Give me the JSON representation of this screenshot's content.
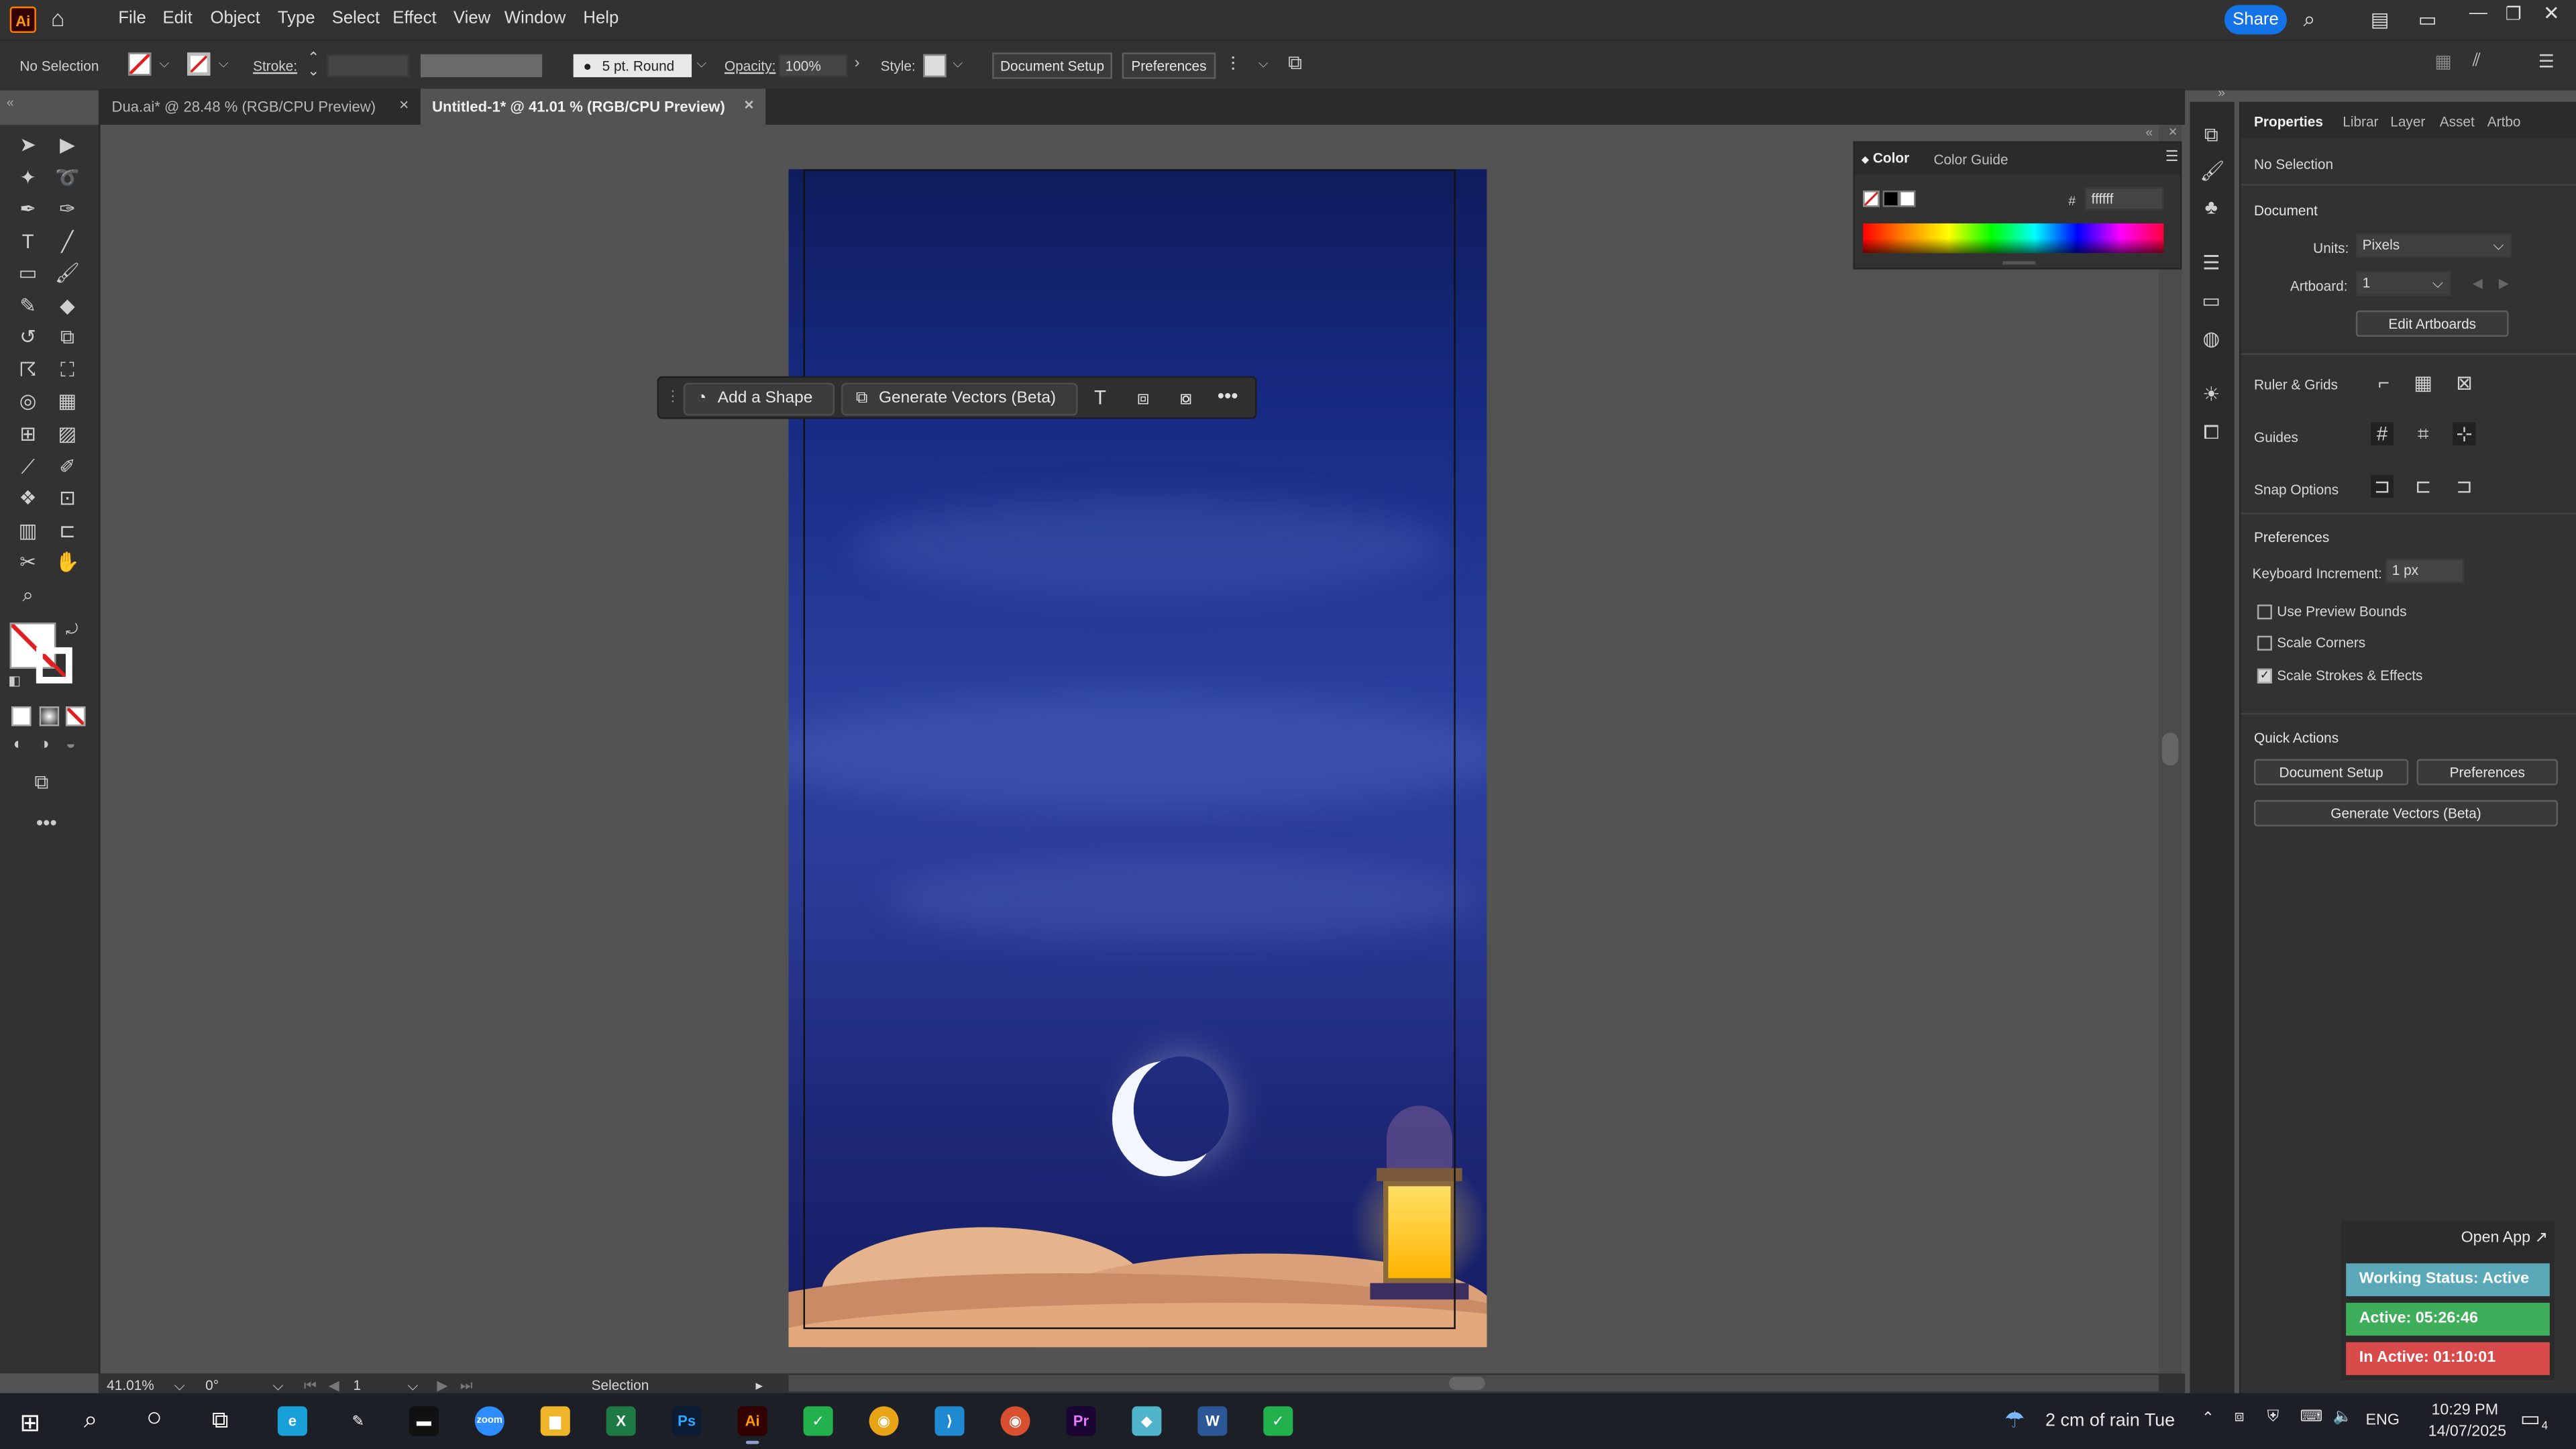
{
  "app": {
    "logo": "Ai"
  },
  "menus": [
    "File",
    "Edit",
    "Object",
    "Type",
    "Select",
    "Effect",
    "View",
    "Window",
    "Help"
  ],
  "header": {
    "share_label": "Share"
  },
  "control_bar": {
    "selection": "No Selection",
    "stroke_label": "Stroke:",
    "brush": "5 pt. Round",
    "opacity_label": "Opacity:",
    "opacity_value": "100%",
    "style_label": "Style:",
    "document_setup": "Document Setup",
    "preferences": "Preferences"
  },
  "tabs": [
    {
      "label": "Dua.ai* @ 28.48 % (RGB/CPU Preview)",
      "active": false
    },
    {
      "label": "Untitled-1* @ 41.01 % (RGB/CPU Preview)",
      "active": true
    }
  ],
  "context_bar": {
    "add_shape": "Add a Shape",
    "generate_vectors": "Generate Vectors (Beta)"
  },
  "color_panel": {
    "tab_color": "Color",
    "tab_guide": "Color Guide",
    "hex_label": "#",
    "hex_value": "ffffff"
  },
  "properties": {
    "tabs": [
      "Properties",
      "Librar",
      "Layer",
      "Asset",
      "Artbo"
    ],
    "selection": "No Selection",
    "document_title": "Document",
    "units_label": "Units:",
    "units_value": "Pixels",
    "artboard_label": "Artboard:",
    "artboard_value": "1",
    "edit_artboards": "Edit Artboards",
    "ruler_grids": "Ruler & Grids",
    "guides": "Guides",
    "snap_options": "Snap Options",
    "preferences_title": "Preferences",
    "keyboard_increment_label": "Keyboard Increment:",
    "keyboard_increment_value": "1 px",
    "checkboxes": [
      {
        "label": "Use Preview Bounds",
        "checked": false
      },
      {
        "label": "Scale Corners",
        "checked": false
      },
      {
        "label": "Scale Strokes & Effects",
        "checked": true
      }
    ],
    "quick_actions_title": "Quick Actions",
    "qa_document_setup": "Document Setup",
    "qa_preferences": "Preferences",
    "qa_generate_vectors": "Generate Vectors (Beta)"
  },
  "status_bar": {
    "zoom": "41.01%",
    "rotation": "0°",
    "artboard": "1",
    "tool": "Selection"
  },
  "widget": {
    "open_app": "Open App ↗",
    "working": "Working Status: Active",
    "active": "Active: 05:26:46",
    "inactive": "In Active: 01:10:01",
    "colors": {
      "working": "#5aa8b8",
      "active": "#3fae5a",
      "inactive": "#d94b4b"
    }
  },
  "taskbar": {
    "weather": "2 cm of rain Tue",
    "lang": "ENG",
    "time": "10:29 PM",
    "date": "14/07/2025",
    "notifications": "4",
    "apps": [
      {
        "name": "edge",
        "glyph": "e",
        "color": "#1aa0d8"
      },
      {
        "name": "pen",
        "glyph": "✎",
        "color": "#1c1f26"
      },
      {
        "name": "terminal",
        "glyph": "▬",
        "color": "#111"
      },
      {
        "name": "zoom",
        "glyph": "zoom",
        "color": "#2d8cff"
      },
      {
        "name": "explorer",
        "glyph": "▆",
        "color": "#f0b429"
      },
      {
        "name": "excel",
        "glyph": "X",
        "color": "#1d7a45"
      },
      {
        "name": "photoshop",
        "glyph": "Ps",
        "color": "#0b1c33"
      },
      {
        "name": "illustrator",
        "glyph": "Ai",
        "color": "#330000"
      },
      {
        "name": "app-green-1",
        "glyph": "✓",
        "color": "#22b14c"
      },
      {
        "name": "chrome",
        "glyph": "◉",
        "color": "#e8a317"
      },
      {
        "name": "vscode",
        "glyph": "⟩",
        "color": "#1f8ad2"
      },
      {
        "name": "chrome-2",
        "glyph": "◉",
        "color": "#d8502f"
      },
      {
        "name": "premiere",
        "glyph": "Pr",
        "color": "#1a0533"
      },
      {
        "name": "app-cyan",
        "glyph": "◆",
        "color": "#4fb3c9"
      },
      {
        "name": "word",
        "glyph": "W",
        "color": "#2b5797"
      },
      {
        "name": "app-green-2",
        "glyph": "✓",
        "color": "#22b14c"
      }
    ]
  }
}
